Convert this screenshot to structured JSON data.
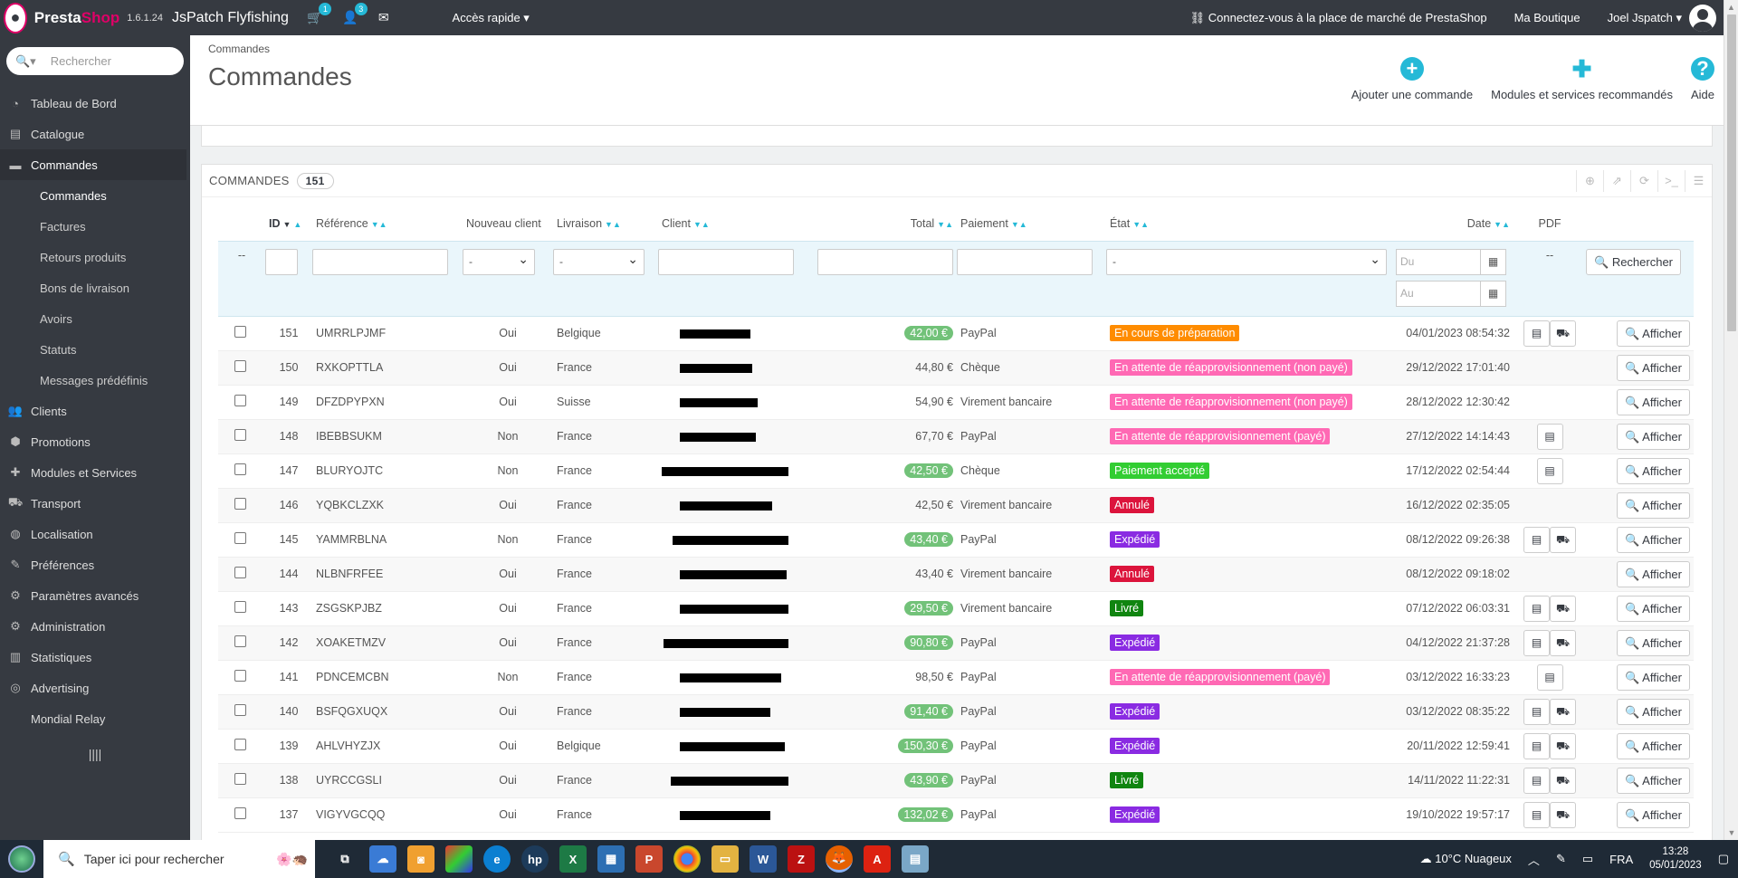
{
  "topbar": {
    "brand_a": "Presta",
    "brand_b": "Shop",
    "version": "1.6.1.24",
    "shop_name": "JsPatch Flyfishing",
    "cart_badge": "1",
    "customer_badge": "3",
    "quick_access": "Accès rapide ▾",
    "marketplace_link": "Connectez-vous à la place de marché de PrestaShop",
    "my_shop": "Ma Boutique",
    "user": "Joel Jspatch ▾"
  },
  "sidebar": {
    "search_placeholder": "Rechercher",
    "items": [
      {
        "label": "Tableau de Bord",
        "icon": "dashboard-icon"
      },
      {
        "label": "Catalogue",
        "icon": "book-icon"
      },
      {
        "label": "Commandes",
        "icon": "credit-card-icon"
      },
      {
        "label": "Clients",
        "icon": "users-icon"
      },
      {
        "label": "Promotions",
        "icon": "tag-icon"
      },
      {
        "label": "Modules et Services",
        "icon": "puzzle-icon"
      },
      {
        "label": "Transport",
        "icon": "truck-icon"
      },
      {
        "label": "Localisation",
        "icon": "globe-icon"
      },
      {
        "label": "Préférences",
        "icon": "wrench-icon"
      },
      {
        "label": "Paramètres avancés",
        "icon": "cogs-icon"
      },
      {
        "label": "Administration",
        "icon": "gear-icon"
      },
      {
        "label": "Statistiques",
        "icon": "bar-chart-icon"
      },
      {
        "label": "Advertising",
        "icon": "target-icon"
      },
      {
        "label": "Mondial Relay",
        "icon": ""
      }
    ],
    "subitems": [
      "Commandes",
      "Factures",
      "Retours produits",
      "Bons de livraison",
      "Avoirs",
      "Statuts",
      "Messages prédéfinis"
    ]
  },
  "header": {
    "breadcrumb": "Commandes",
    "title": "Commandes",
    "actions": [
      "Ajouter une commande",
      "Modules et services recommandés",
      "Aide"
    ]
  },
  "panel": {
    "title": "COMMANDES",
    "count": "151",
    "columns": [
      "ID",
      "Référence",
      "Nouveau client",
      "Livraison",
      "Client",
      "Total",
      "Paiement",
      "État",
      "Date",
      "PDF"
    ],
    "filters": {
      "id_placeholder": "--",
      "select_default": "-",
      "date_from": "Du",
      "date_to": "Au",
      "pdf_placeholder": "--",
      "search_button": "Rechercher"
    },
    "view_label": "Afficher"
  },
  "orders": [
    {
      "id": "151",
      "ref": "UMRRLPJMF",
      "new": "Oui",
      "country": "Belgique",
      "client_redact": 78,
      "total": "42,00 €",
      "total_pill": true,
      "payment": "PayPal",
      "state": "En cours de préparation",
      "state_color": "#ff8c00",
      "date": "04/01/2023 08:54:32",
      "pdf": [
        "invoice",
        "delivery"
      ]
    },
    {
      "id": "150",
      "ref": "RXKOPTTLA",
      "new": "Oui",
      "country": "France",
      "client_redact": 80,
      "total": "44,80 €",
      "total_pill": false,
      "payment": "Chèque",
      "state": "En attente de réapprovisionnement (non payé)",
      "state_color": "#ff69b4",
      "date": "29/12/2022 17:01:40",
      "pdf": []
    },
    {
      "id": "149",
      "ref": "DFZDPYPXN",
      "new": "Oui",
      "country": "Suisse",
      "client_redact": 86,
      "total": "54,90 €",
      "total_pill": false,
      "payment": "Virement bancaire",
      "state": "En attente de réapprovisionnement (non payé)",
      "state_color": "#ff69b4",
      "date": "28/12/2022 12:30:42",
      "pdf": []
    },
    {
      "id": "148",
      "ref": "IBEBBSUKM",
      "new": "Non",
      "country": "France",
      "client_redact": 84,
      "total": "67,70 €",
      "total_pill": false,
      "payment": "PayPal",
      "state": "En attente de réapprovisionnement (payé)",
      "state_color": "#ff69b4",
      "date": "27/12/2022 14:14:43",
      "pdf": [
        "invoice"
      ]
    },
    {
      "id": "147",
      "ref": "BLURYOJTC",
      "new": "Non",
      "country": "France",
      "client_redact": 140,
      "total": "42,50 €",
      "total_pill": true,
      "payment": "Chèque",
      "state": "Paiement accepté",
      "state_color": "#32cd32",
      "date": "17/12/2022 02:54:44",
      "pdf": [
        "invoice"
      ]
    },
    {
      "id": "146",
      "ref": "YQBKCLZXK",
      "new": "Oui",
      "country": "France",
      "client_redact": 102,
      "total": "42,50 €",
      "total_pill": false,
      "payment": "Virement bancaire",
      "state": "Annulé",
      "state_color": "#dc143c",
      "date": "16/12/2022 02:35:05",
      "pdf": []
    },
    {
      "id": "145",
      "ref": "YAMMRBLNA",
      "new": "Non",
      "country": "France",
      "client_redact": 128,
      "total": "43,40 €",
      "total_pill": true,
      "payment": "PayPal",
      "state": "Expédié",
      "state_color": "#8a2be2",
      "date": "08/12/2022 09:26:38",
      "pdf": [
        "invoice",
        "delivery"
      ]
    },
    {
      "id": "144",
      "ref": "NLBNFRFEE",
      "new": "Oui",
      "country": "France",
      "client_redact": 118,
      "total": "43,40 €",
      "total_pill": false,
      "payment": "Virement bancaire",
      "state": "Annulé",
      "state_color": "#dc143c",
      "date": "08/12/2022 09:18:02",
      "pdf": []
    },
    {
      "id": "143",
      "ref": "ZSGSKPJBZ",
      "new": "Oui",
      "country": "France",
      "client_redact": 120,
      "total": "29,50 €",
      "total_pill": true,
      "payment": "Virement bancaire",
      "state": "Livré",
      "state_color": "#108510",
      "date": "07/12/2022 06:03:31",
      "pdf": [
        "invoice",
        "delivery"
      ]
    },
    {
      "id": "142",
      "ref": "XOAKETMZV",
      "new": "Oui",
      "country": "France",
      "client_redact": 138,
      "total": "90,80 €",
      "total_pill": true,
      "payment": "PayPal",
      "state": "Expédié",
      "state_color": "#8a2be2",
      "date": "04/12/2022 21:37:28",
      "pdf": [
        "invoice",
        "delivery"
      ]
    },
    {
      "id": "141",
      "ref": "PDNCEMCBN",
      "new": "Non",
      "country": "France",
      "client_redact": 112,
      "total": "98,50 €",
      "total_pill": false,
      "payment": "PayPal",
      "state": "En attente de réapprovisionnement (payé)",
      "state_color": "#ff69b4",
      "date": "03/12/2022 16:33:23",
      "pdf": [
        "invoice"
      ]
    },
    {
      "id": "140",
      "ref": "BSFQGXUQX",
      "new": "Oui",
      "country": "France",
      "client_redact": 100,
      "total": "91,40 €",
      "total_pill": true,
      "payment": "PayPal",
      "state": "Expédié",
      "state_color": "#8a2be2",
      "date": "03/12/2022 08:35:22",
      "pdf": [
        "invoice",
        "delivery"
      ]
    },
    {
      "id": "139",
      "ref": "AHLVHYZJX",
      "new": "Oui",
      "country": "Belgique",
      "client_redact": 116,
      "total": "150,30 €",
      "total_pill": true,
      "payment": "PayPal",
      "state": "Expédié",
      "state_color": "#8a2be2",
      "date": "20/11/2022 12:59:41",
      "pdf": [
        "invoice",
        "delivery"
      ]
    },
    {
      "id": "138",
      "ref": "UYRCCGSLI",
      "new": "Oui",
      "country": "France",
      "client_redact": 130,
      "total": "43,90 €",
      "total_pill": true,
      "payment": "PayPal",
      "state": "Livré",
      "state_color": "#108510",
      "date": "14/11/2022 11:22:31",
      "pdf": [
        "invoice",
        "delivery"
      ]
    },
    {
      "id": "137",
      "ref": "VIGYVGCQQ",
      "new": "Oui",
      "country": "France",
      "client_redact": 100,
      "total": "132,02 €",
      "total_pill": true,
      "payment": "PayPal",
      "state": "Expédié",
      "state_color": "#8a2be2",
      "date": "19/10/2022 19:57:17",
      "pdf": [
        "invoice",
        "delivery"
      ]
    }
  ],
  "taskbar": {
    "search_placeholder": "Taper ici pour rechercher",
    "weather": "10°C  Nuageux",
    "lang": "FRA",
    "time": "13:28",
    "date": "05/01/2023"
  }
}
